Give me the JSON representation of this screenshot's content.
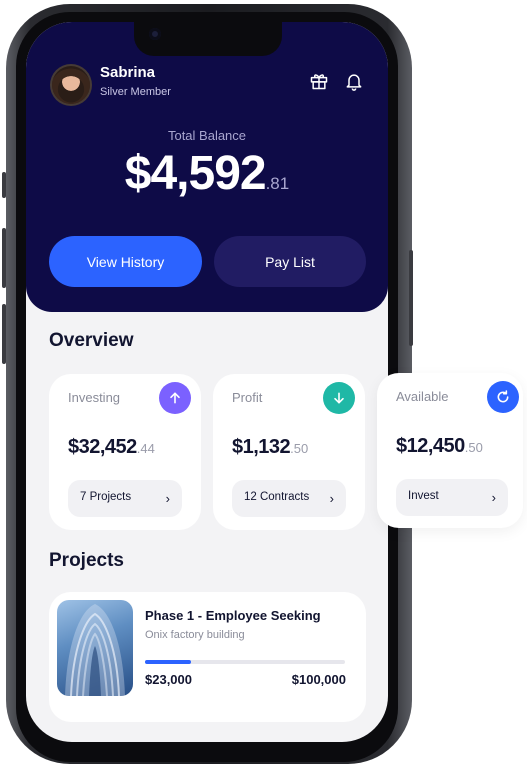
{
  "profile": {
    "name": "Sabrina",
    "tier": "Silver Member"
  },
  "header_icons": [
    "gift-icon",
    "bell-icon"
  ],
  "balance": {
    "label": "Total Balance",
    "main": "$4,592",
    "cents": ".81"
  },
  "actions": {
    "view_history": "View History",
    "pay_list": "Pay List"
  },
  "overview": {
    "title": "Overview",
    "cards": [
      {
        "label": "Investing",
        "amount": "$32,452",
        "cents": ".44",
        "chip": "7 Projects",
        "badge_icon": "arrow-up-icon",
        "badge_color": "#7b61ff"
      },
      {
        "label": "Profit",
        "amount": "$1,132",
        "cents": ".50",
        "chip": "12 Contracts",
        "badge_icon": "arrow-down-icon",
        "badge_color": "#1fb8a6"
      },
      {
        "label": "Available",
        "amount": "$12,450",
        "cents": ".50",
        "chip": "Invest",
        "badge_icon": "refresh-icon",
        "badge_color": "#2c63ff"
      }
    ]
  },
  "projects": {
    "title": "Projects",
    "items": [
      {
        "title": "Phase 1 - Employee Seeking",
        "subtitle": "Onix factory building",
        "current": "$23,000",
        "goal": "$100,000",
        "progress": 0.23
      }
    ]
  },
  "colors": {
    "header_bg": "#0e0b47",
    "primary": "#2c63ff",
    "secondary_button": "#211c63",
    "page_bg": "#f3f3f5"
  }
}
